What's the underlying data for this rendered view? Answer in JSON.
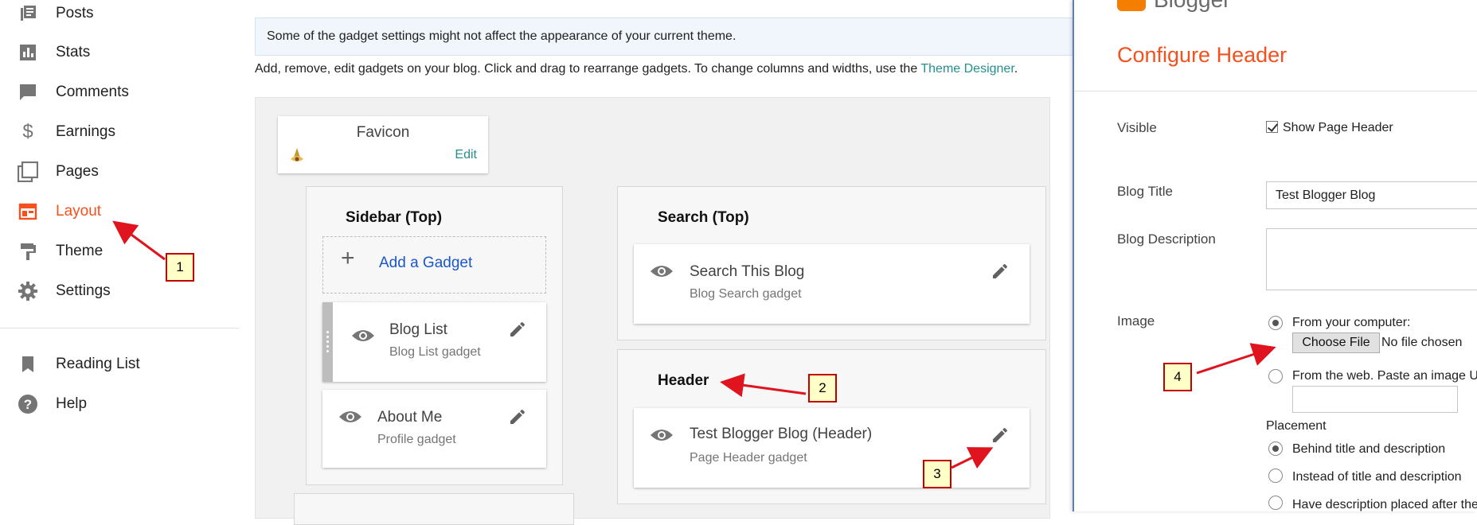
{
  "sidebar": {
    "items": [
      {
        "label": "Posts",
        "icon": "posts-icon"
      },
      {
        "label": "Stats",
        "icon": "stats-icon"
      },
      {
        "label": "Comments",
        "icon": "comments-icon"
      },
      {
        "label": "Earnings",
        "icon": "earnings-icon"
      },
      {
        "label": "Pages",
        "icon": "pages-icon"
      },
      {
        "label": "Layout",
        "icon": "layout-icon",
        "active": true
      },
      {
        "label": "Theme",
        "icon": "theme-icon"
      },
      {
        "label": "Settings",
        "icon": "gear-icon"
      },
      {
        "label": "Reading List",
        "icon": "bookmark-icon"
      },
      {
        "label": "Help",
        "icon": "help-icon"
      }
    ]
  },
  "main": {
    "notice": "Some of the gadget settings might not affect the appearance of your current theme.",
    "intro_text": "Add, remove, edit gadgets on your blog. Click and drag to rearrange gadgets. To change columns and widths, use the ",
    "intro_link": "Theme Designer",
    "intro_end": ".",
    "favicon": {
      "title": "Favicon",
      "edit_label": "Edit"
    },
    "sidebar_top": {
      "title": "Sidebar (Top)",
      "add_gadget_label": "Add a Gadget",
      "gadgets": [
        {
          "name": "Blog List",
          "type": "Blog List gadget"
        },
        {
          "name": "About Me",
          "type": "Profile gadget"
        }
      ]
    },
    "search_top": {
      "title": "Search (Top)",
      "gadgets": [
        {
          "name": "Search This Blog",
          "type": "Blog Search gadget"
        }
      ]
    },
    "header": {
      "title": "Header",
      "gadgets": [
        {
          "name": "Test Blogger Blog (Header)",
          "type": "Page Header gadget"
        }
      ]
    }
  },
  "panel": {
    "brand": "Blogger",
    "title": "Configure Header",
    "visible_label": "Visible",
    "show_header_label": "Show Page Header",
    "show_header_checked": true,
    "blog_title_label": "Blog Title",
    "blog_title_value": "Test Blogger Blog",
    "blog_description_label": "Blog Description",
    "image_label": "Image",
    "from_computer_label": "From your computer:",
    "choose_file_label": "Choose File",
    "no_file_label": "No file chosen",
    "from_web_label": "From the web. Paste an image U",
    "placement_label": "Placement",
    "placement_options": [
      "Behind title and description",
      "Instead of title and description",
      "Have description placed after the"
    ],
    "placement_selected": 0
  },
  "annotations": [
    "1",
    "2",
    "3",
    "4"
  ],
  "colors": {
    "accent": "#f4511e",
    "link": "#268e8e",
    "add_gadget": "#1a57c7",
    "callout_border": "#c20000",
    "callout_fill": "#ffffc8",
    "arrow": "#e0141e"
  }
}
